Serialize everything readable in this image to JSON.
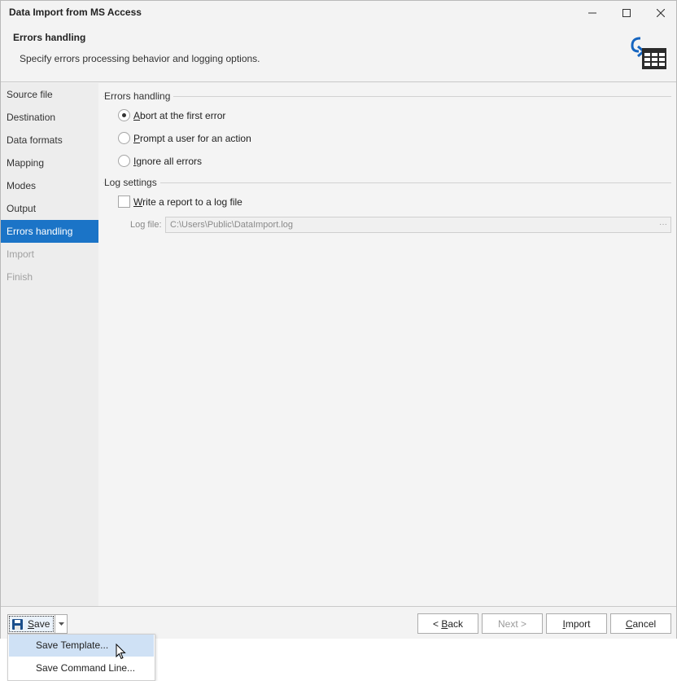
{
  "window": {
    "title": "Data Import from MS Access"
  },
  "header": {
    "title": "Errors handling",
    "description": "Specify errors processing behavior and logging options."
  },
  "sidebar": {
    "items": [
      {
        "label": "Source file",
        "state": "normal"
      },
      {
        "label": "Destination",
        "state": "normal"
      },
      {
        "label": "Data formats",
        "state": "normal"
      },
      {
        "label": "Mapping",
        "state": "normal"
      },
      {
        "label": "Modes",
        "state": "normal"
      },
      {
        "label": "Output",
        "state": "normal"
      },
      {
        "label": "Errors handling",
        "state": "active"
      },
      {
        "label": "Import",
        "state": "disabled"
      },
      {
        "label": "Finish",
        "state": "disabled"
      }
    ]
  },
  "errors_group": {
    "label": "Errors handling",
    "options": [
      {
        "accel": "A",
        "rest": "bort at the first error",
        "checked": true
      },
      {
        "accel": "P",
        "rest": "rompt a user for an action",
        "checked": false
      },
      {
        "accel": "I",
        "rest": "gnore all errors",
        "checked": false
      }
    ]
  },
  "log_group": {
    "label": "Log settings",
    "write_report": {
      "accel": "W",
      "rest": "rite a report to a log file",
      "checked": false
    },
    "log_file_label": "Log file:",
    "log_file_value": "C:\\Users\\Public\\DataImport.log",
    "browse_label": "···"
  },
  "footer": {
    "save": {
      "accel": "S",
      "rest": "ave"
    },
    "back": {
      "prefix": "< ",
      "accel": "B",
      "rest": "ack"
    },
    "next": {
      "label": "Next >",
      "enabled": false
    },
    "import": {
      "accel": "I",
      "rest": "mport"
    },
    "cancel": {
      "accel": "C",
      "rest": "ancel"
    }
  },
  "save_menu": {
    "items": [
      {
        "label": "Save Template...",
        "highlighted": true
      },
      {
        "label": "Save Command Line...",
        "highlighted": false
      }
    ]
  },
  "colors": {
    "accent": "#1b74c7",
    "icon_blue": "#1565c0",
    "menu_hover": "#cfe1f5"
  }
}
